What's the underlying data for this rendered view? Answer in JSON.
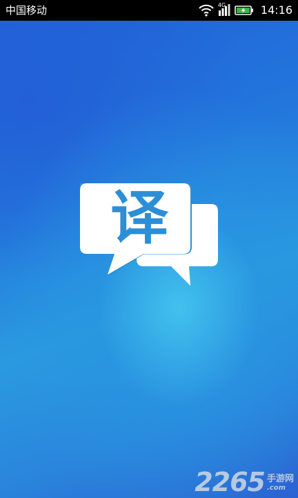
{
  "status_bar": {
    "carrier": "中国移动",
    "network_type": "4G",
    "time": "14:16",
    "icons": [
      "wifi-icon",
      "signal-icon",
      "battery-charging-icon"
    ]
  },
  "splash": {
    "logo_char": "译",
    "logo_icon": "chat-bubbles-icon",
    "colors": {
      "background_primary": "#2377dc",
      "background_glow": "#46c8f0",
      "logo_bubble": "#ffffff",
      "logo_text": "#2b8fd8"
    }
  },
  "watermark": {
    "number": "2265",
    "site_name": "手游网",
    "domain": ".com"
  }
}
